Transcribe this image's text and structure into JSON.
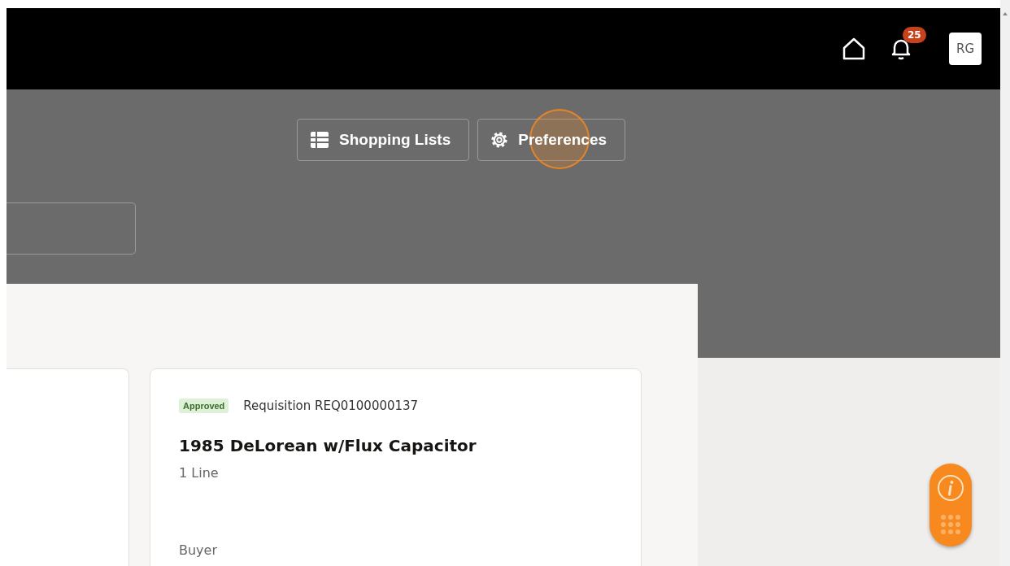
{
  "header": {
    "notifications": {
      "count": "25"
    },
    "avatar": {
      "initials": "RG"
    }
  },
  "toolbar": {
    "buttons": [
      {
        "label": "Shopping Lists",
        "kind": "list"
      },
      {
        "label": "Preferences",
        "kind": "settings",
        "highlighted": true
      }
    ]
  },
  "cards": [
    {
      "kind": "partial"
    },
    {
      "kind": "requisition",
      "status": "Approved",
      "color": "#dff0d8",
      "number": "Requisition REQ0100000137",
      "title": "1985 DeLorean w/Flux Capacitor",
      "lines": "1 Line",
      "field_label": "Buyer"
    }
  ]
}
